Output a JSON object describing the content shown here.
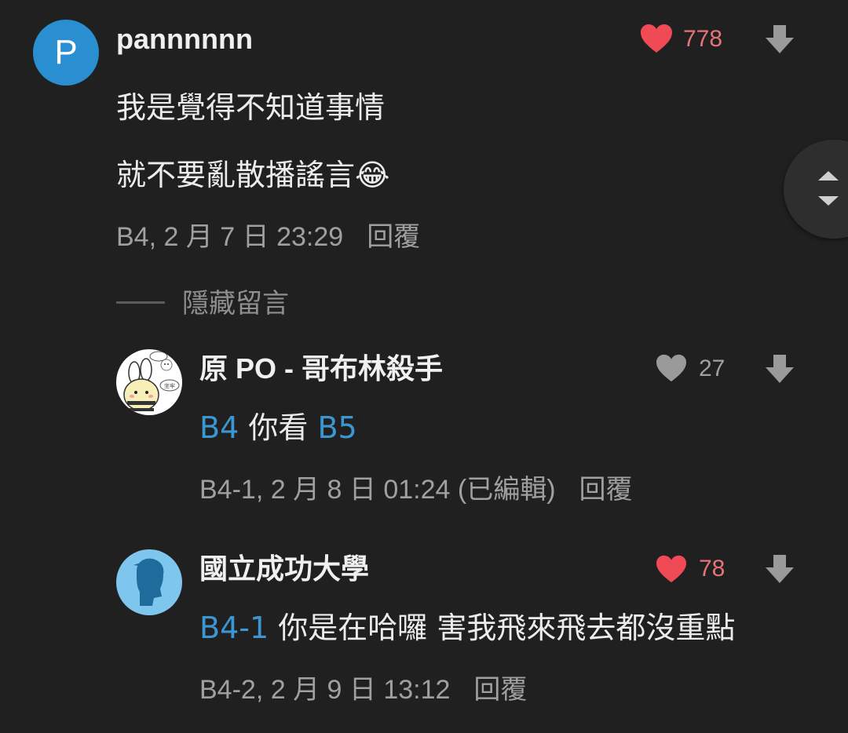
{
  "comments": [
    {
      "avatar_letter": "P",
      "author": "pannnnnn",
      "likes": "778",
      "like_state": "liked",
      "lines": [
        "我是覺得不知道事情",
        "就不要亂散播謠言"
      ],
      "emoji": "😂",
      "floor": "B4",
      "date": "2 月 7 日 23:29",
      "reply": "回覆"
    }
  ],
  "hide_label": "隱藏留言",
  "replies": [
    {
      "author": "原 PO - 哥布林殺手",
      "likes": "27",
      "like_state": "neutral",
      "tag1": "B4",
      "text": "你看",
      "tag2": "B5",
      "floor": "B4-1",
      "date": "2 月 8 日 01:24 (已編輯)",
      "reply": "回覆",
      "avatar_bubbles": [
        "",
        "坐牢"
      ]
    },
    {
      "author": "國立成功大學",
      "likes": "78",
      "like_state": "liked",
      "tag1": "B4-1",
      "text": "你是在哈囉 害我飛來飛去都沒重點",
      "floor": "B4-2",
      "date": "2 月 9 日 13:12",
      "reply": "回覆"
    }
  ],
  "colors": {
    "background": "#202020",
    "liked_heart": "#ef4a55",
    "liked_count": "#e5747a",
    "neutral_heart": "#9a9a9a",
    "tag_blue": "#3a97d4",
    "avatar_blue": "#2a8fd0",
    "avatar_light_blue": "#7fc6ef"
  },
  "icons": {
    "heart": "heart-icon",
    "downvote": "arrow-down-icon",
    "scroll": "scroll-up-down-icon"
  }
}
